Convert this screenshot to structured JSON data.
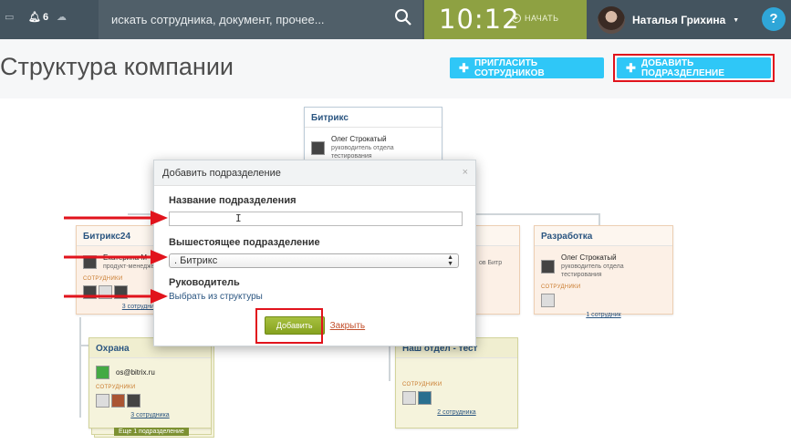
{
  "topbar": {
    "notifications_count": "6",
    "search_placeholder": "искать сотрудника, документ, прочее...",
    "clock_time": "10:12",
    "clock_start_label": "НАЧАТЬ",
    "user_name": "Наталья Грихина",
    "help_label": "?"
  },
  "page": {
    "title": "Структура компании",
    "invite_button": "ПРИГЛАСИТЬ СОТРУДНИКОВ",
    "add_department_button": "ДОБАВИТЬ ПОДРАЗДЕЛЕНИЕ"
  },
  "cards": {
    "root": {
      "title": "Битрикс",
      "head_name": "Олег Строкатый",
      "head_position": "руководитель отдела тестирования"
    },
    "bitrix24": {
      "title": "Битрикс24",
      "head_name": "Екатерина М",
      "head_position": "продукт-менеджер",
      "employees_label": "СОТРУДНИКИ",
      "employees_link": "3 сотрудника"
    },
    "middle": {
      "position_fragment": "ов Битр"
    },
    "razrabotka": {
      "title": "Разработка",
      "head_name": "Олег Строкатый",
      "head_position": "руководитель отдела тестирования",
      "employees_label": "СОТРУДНИКИ",
      "employees_link": "1 сотрудник"
    },
    "ohrana": {
      "title": "Охрана",
      "head_name": "os@bitrix.ru",
      "employees_label": "СОТРУДНИКИ",
      "employees_link": "3 сотрудника",
      "more_badge": "Еще 1 подразделение"
    },
    "nash_otdel": {
      "title": "Наш отдел - тест",
      "employees_label": "СОТРУДНИКИ",
      "employees_link": "2 сотрудника"
    }
  },
  "dialog": {
    "title": "Добавить подразделение",
    "close_glyph": "×",
    "name_label": "Название подразделения",
    "name_value": "",
    "parent_label": "Вышестоящее подразделение",
    "parent_value": ". Битрикс",
    "head_label": "Руководитель",
    "choose_link": "Выбрать из структуры",
    "add_button": "Добавить",
    "close_link": "Закрыть"
  },
  "icons": {
    "bell": "bell-icon",
    "search": "search-icon",
    "help": "help-icon"
  },
  "colors": {
    "topbar": "#44545f",
    "clock": "#8ea142",
    "accent_blue": "#2fc7f7",
    "highlight_red": "#e1131c",
    "add_green": "#94b22c"
  }
}
